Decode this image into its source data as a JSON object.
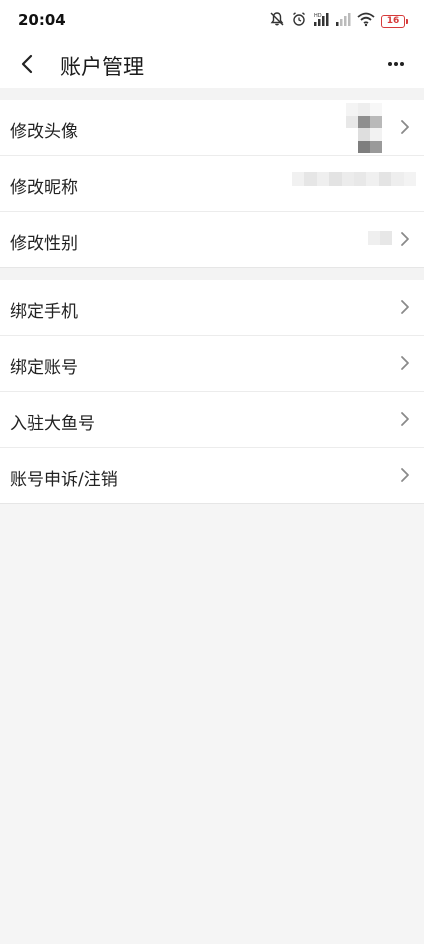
{
  "status": {
    "time": "20:04",
    "battery": "16"
  },
  "header": {
    "title": "账户管理"
  },
  "group_profile": {
    "items": [
      {
        "label": "修改头像"
      },
      {
        "label": "修改昵称"
      },
      {
        "label": "修改性别"
      }
    ]
  },
  "group_account": {
    "items": [
      {
        "label": "绑定手机"
      },
      {
        "label": "绑定账号"
      },
      {
        "label": "入驻大鱼号"
      },
      {
        "label": "账号申诉/注销"
      }
    ]
  },
  "icons": {
    "back": "chevron-left-icon",
    "more": "more-horizontal-icon",
    "row_arrow": "chevron-right-icon",
    "status": [
      "bell-off-icon",
      "alarm-icon",
      "signal-icon",
      "signal-weak-icon",
      "wifi-icon",
      "battery-icon"
    ]
  },
  "colors": {
    "battery_low": "#d63b3b",
    "background": "#f5f5f5",
    "row_background": "#ffffff",
    "divider": "#ececec"
  }
}
